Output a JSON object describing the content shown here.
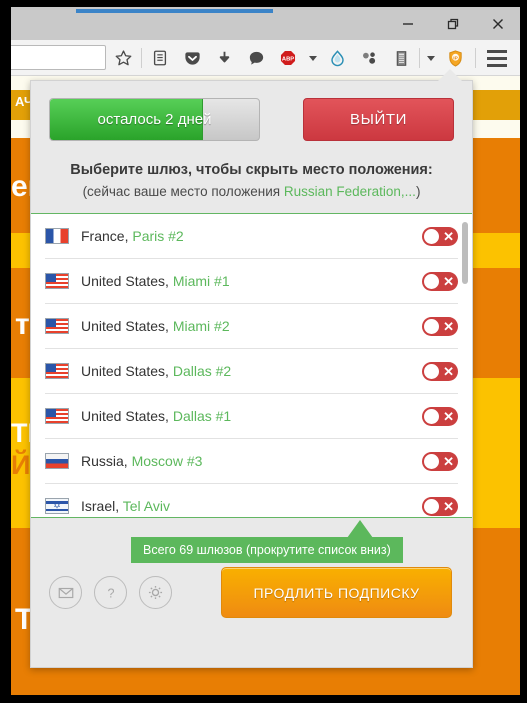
{
  "window": {
    "controls": {
      "minimize": "minimize",
      "maximize": "restore",
      "close": "close"
    }
  },
  "toolbar": {
    "url_value": "",
    "url_placeholder": "",
    "icons": [
      "bookmark-star-icon",
      "reading-list-icon",
      "pocket-icon",
      "download-icon",
      "chat-bubble-icon",
      "adblock-plus-icon",
      "water-drop-icon",
      "molecule-icon",
      "clipboard-icon",
      "ip-shield-icon",
      "hamburger-menu-icon"
    ],
    "abp_label": "ABP",
    "ip_label": "IP"
  },
  "page_behind": {
    "band_download": "АЧАТ",
    "band_line1": "его",
    "band_line2": "ти",
    "band_line3a": "ТЬ",
    "band_line3b": "ЙТ",
    "band_line4": "ТН"
  },
  "popup": {
    "progress": {
      "label": "осталось 2 дней",
      "percent": 73
    },
    "logout_label": "ВЫЙТИ",
    "heading": "Выберите шлюз, чтобы скрыть место положения:",
    "subheading_prefix": "(сейчас ваше место положения ",
    "subheading_location": "Russian Federation,...",
    "subheading_suffix": ")",
    "gateways": [
      {
        "country": "France,",
        "city": "Paris #2",
        "flag": "fr",
        "enabled": false
      },
      {
        "country": "United States,",
        "city": "Miami #1",
        "flag": "us",
        "enabled": false
      },
      {
        "country": "United States,",
        "city": "Miami #2",
        "flag": "us",
        "enabled": false
      },
      {
        "country": "United States,",
        "city": "Dallas #2",
        "flag": "us",
        "enabled": false
      },
      {
        "country": "United States,",
        "city": "Dallas #1",
        "flag": "us",
        "enabled": false
      },
      {
        "country": "Russia,",
        "city": "Moscow #3",
        "flag": "ru",
        "enabled": false
      },
      {
        "country": "Israel,",
        "city": "Tel Aviv",
        "flag": "il",
        "enabled": false
      }
    ],
    "tooltip": "Всего 69 шлюзов (прокрутите список вниз)",
    "footer": {
      "mail_icon": "envelope-icon",
      "help_icon": "question-mark-icon",
      "settings_icon": "gear-icon",
      "renew_label": "ПРОДЛИТЬ ПОДПИСКУ"
    }
  },
  "colors": {
    "green": "#5cb85c",
    "red": "#cc3840",
    "orange": "#ef8b12",
    "yellow": "#fcc200",
    "popup_bg": "#e9e9e9"
  }
}
